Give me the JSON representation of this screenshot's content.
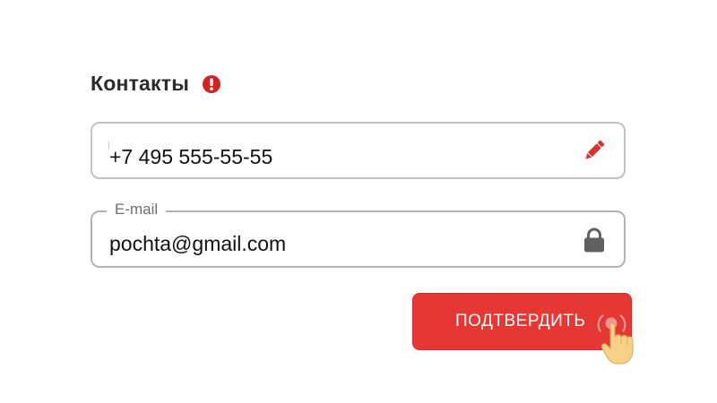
{
  "form": {
    "section_title": "Контакты",
    "alert_icon": "exclamation-circle-icon",
    "phone": {
      "value": "+7 495 555-55-55",
      "icon": "pencil-icon"
    },
    "email": {
      "label": "E-mail",
      "value": "pochta@gmail.com",
      "icon": "lock-icon"
    },
    "submit_label": "ПОДТВЕРДИТЬ"
  },
  "colors": {
    "accent": "#e53734",
    "alert": "#d32323",
    "text": "#111111",
    "label": "#6f6f6f",
    "border": "#c2c2c2",
    "lock": "#606060"
  },
  "cursor": "hand-pointer-icon"
}
